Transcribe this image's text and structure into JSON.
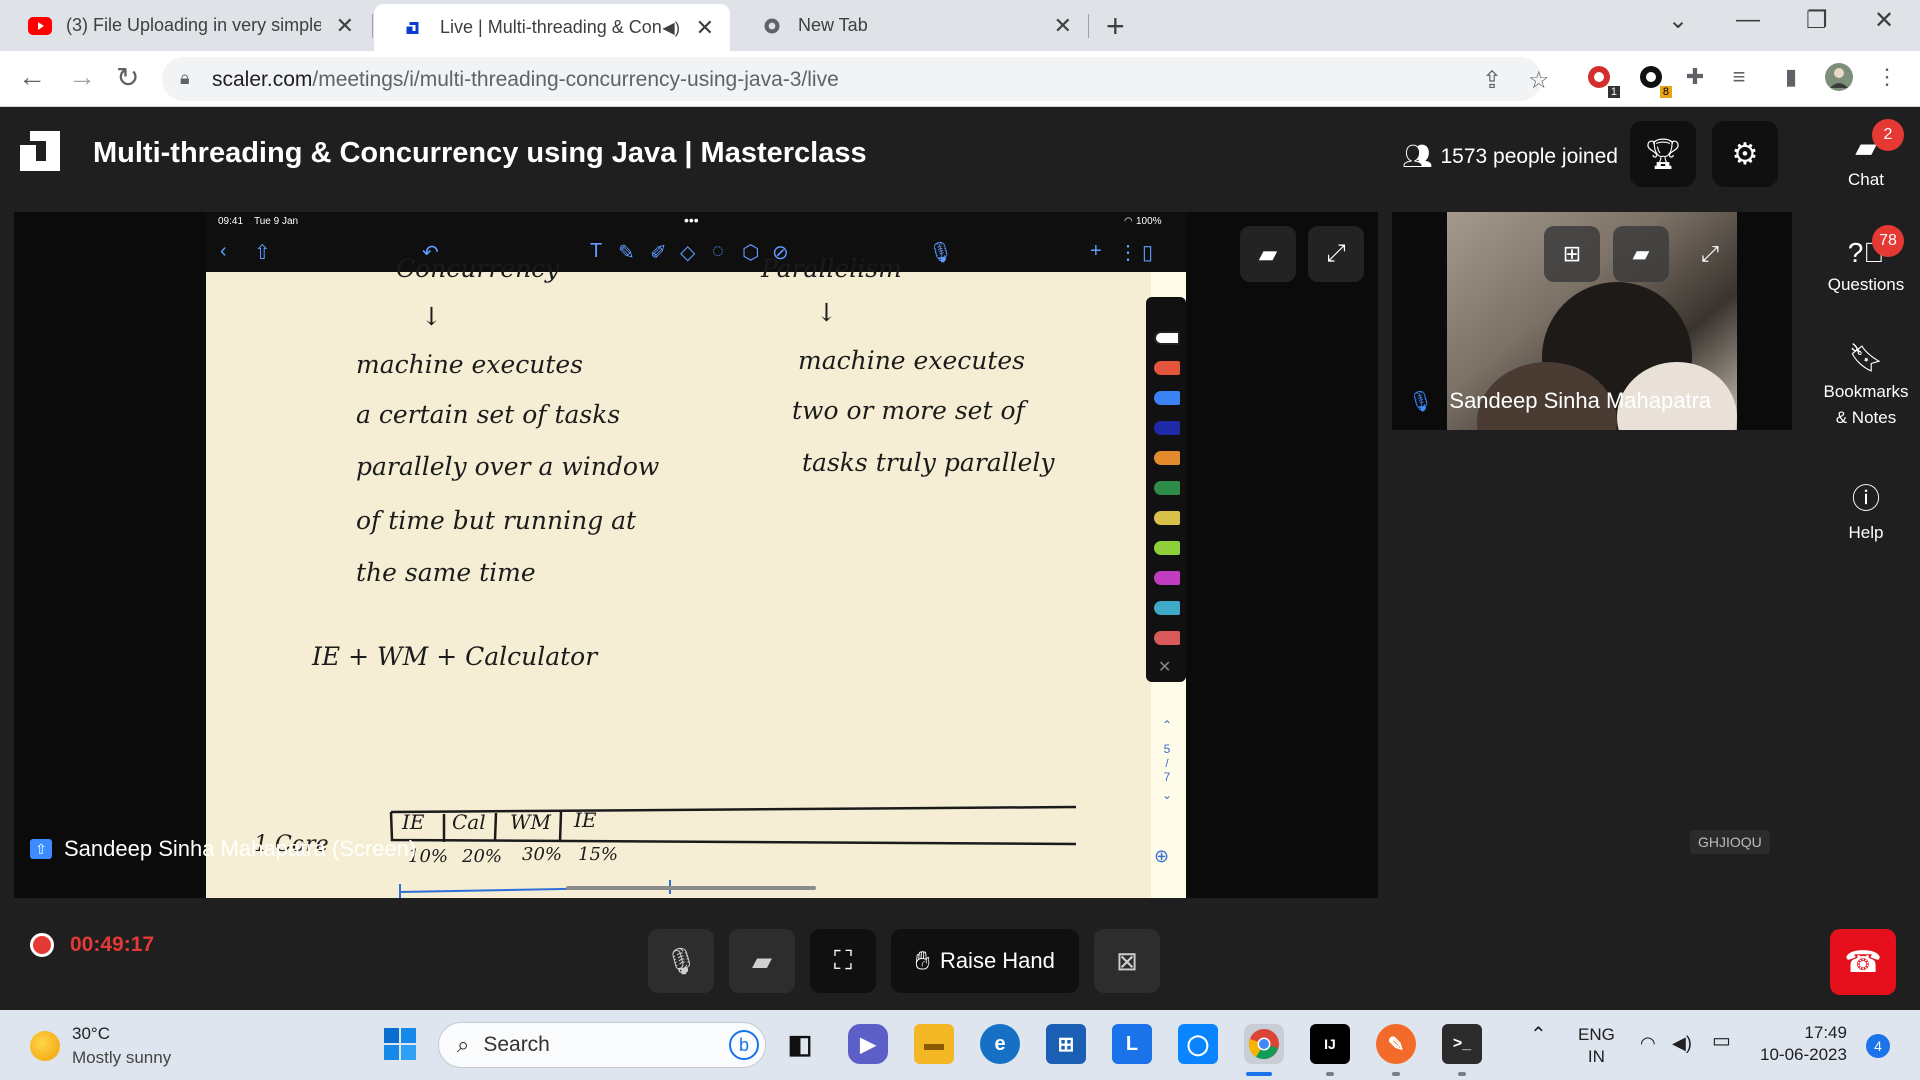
{
  "browser": {
    "tabs": [
      {
        "title": "(3) File Uploading in very simple",
        "favicon": "youtube-icon"
      },
      {
        "title": "Live | Multi-threading & Con",
        "favicon": "scaler-icon",
        "audio": "speaker-icon"
      },
      {
        "title": "New Tab",
        "favicon": "chrome-icon"
      }
    ],
    "url_host": "scaler.com",
    "url_path": "/meetings/i/multi-threading-concurrency-using-java-3/live",
    "extension_badges": {
      "ext1": "1",
      "ext2": "8"
    }
  },
  "app": {
    "title": "Multi-threading & Concurrency using Java | Masterclass",
    "people_joined": "1573 people joined",
    "rail": {
      "chat": {
        "label": "Chat",
        "badge": "2"
      },
      "questions": {
        "label": "Questions",
        "badge": "78"
      },
      "bookmarks": {
        "label_1": "Bookmarks",
        "label_2": "& Notes"
      },
      "help": {
        "label": "Help"
      }
    },
    "screen_share_label": "Sandeep Sinha Mahapatra (Screen)",
    "camera_label": "Sandeep Sinha Mahapatra",
    "session_code": "GHJIOQU",
    "recording_time": "00:49:17",
    "raise_hand_label": "Raise Hand"
  },
  "ipad": {
    "time": "09:41",
    "date": "Tue 9 Jan",
    "battery": "100%",
    "notes": {
      "left_heading": "Concurrency",
      "right_heading": "Parallelism",
      "arrow": "↓",
      "left_lines": [
        "machine executes",
        "a certain set of tasks",
        "parallely over a window",
        "of time but running at",
        "the same time"
      ],
      "right_lines": [
        "machine executes",
        "two or more set of",
        "tasks truly parallely"
      ],
      "example": "IE + WM + Calculator",
      "core_label": "1 Core",
      "timeline_segments": [
        "IE",
        "Cal",
        "WM",
        "IE"
      ],
      "timeline_pcts": [
        "10%",
        "20%",
        "30%",
        "15%"
      ]
    },
    "page_indicator": [
      "5",
      "/",
      "7"
    ]
  },
  "taskbar": {
    "weather_temp": "30°C",
    "weather_desc": "Mostly sunny",
    "search_placeholder": "Search",
    "lang_1": "ENG",
    "lang_2": "IN",
    "time": "17:49",
    "date": "10-06-2023",
    "notifications": "4"
  },
  "colors": {
    "accent_red": "#e53935",
    "leave_red": "#e5101b",
    "brand_blue": "#1a73e8"
  }
}
